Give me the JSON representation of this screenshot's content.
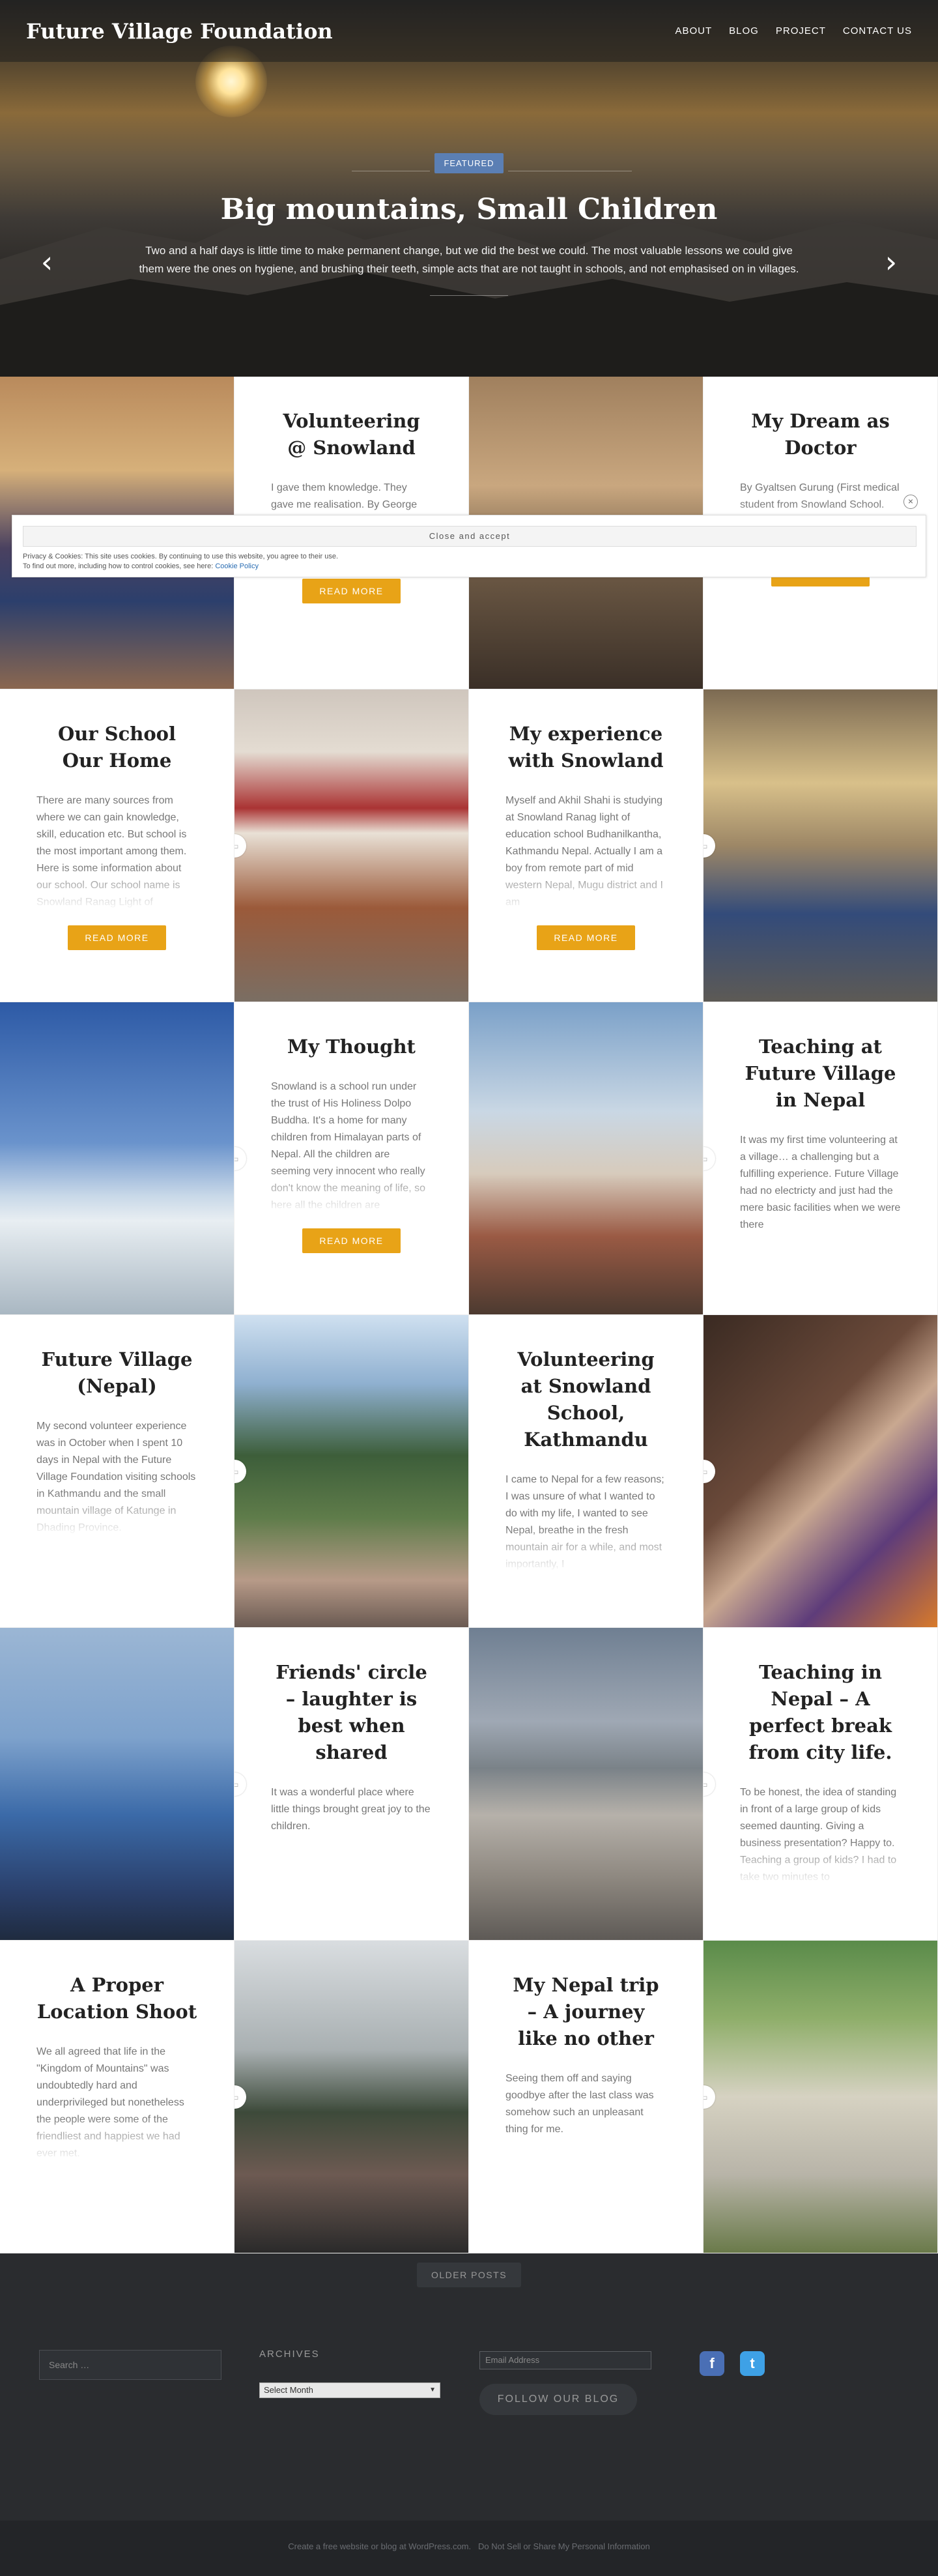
{
  "site": {
    "title": "Future Village Foundation"
  },
  "nav": [
    {
      "label": "ABOUT"
    },
    {
      "label": "BLOG"
    },
    {
      "label": "PROJECT"
    },
    {
      "label": "CONTACT US"
    }
  ],
  "hero": {
    "badge": "FEATURED",
    "title": "Big mountains, Small Children",
    "excerpt": "Two and a half days is little time to make permanent change, but we did the best we could. The most valuable lessons we could give them were the ones on hygiene, and brushing their teeth, simple acts that are not taught in schools, and not emphasised on in villages.",
    "prev_icon": "chevron-left-icon",
    "next_icon": "chevron-right-icon"
  },
  "posts": [
    {
      "title": "Volunteering @ Snowland",
      "excerpt": "I gave them knowledge. They gave me realisation. By George Cotterill. I spent two weeks volunteering at Snowland school in Kathmandu, Nepal. After",
      "read_more": "READ MORE"
    },
    {
      "title": "My Dream as Doctor",
      "excerpt": "By Gyaltsen Gurung (First medical student from Snowland School. Currently studying in 2nd year of MBBS (Bachelor of Medicine and",
      "read_more": "READ MORE"
    },
    {
      "title": "Our School Our Home",
      "excerpt": "There are many sources from where we can gain knowledge, skill, education etc. But school is the most important among them. Here is some information about our school. Our school name is Snowland Ranag Light of",
      "read_more": "READ MORE"
    },
    {
      "title": "My experience with Snowland",
      "excerpt": "Myself and Akhil Shahi is studying at Snowland Ranag light of education school Budhanilkantha, Kathmandu Nepal. Actually I am a boy from remote part of mid western Nepal, Mugu district and I am",
      "read_more": "READ MORE"
    },
    {
      "title": "My Thought",
      "excerpt": "Snowland is a school run under the trust of His Holiness Dolpo Buddha. It's a home for many children from Himalayan parts of Nepal. All the children are seeming very innocent who really don't know the meaning of life, so here all the children are",
      "read_more": "READ MORE"
    },
    {
      "title": "Teaching at Future Village in Nepal",
      "excerpt": "It was my first time volunteering at a village… a challenging but a fulfilling experience. Future Village had no electricty and just had the mere basic facilities when we were there"
    },
    {
      "title": "Future Village (Nepal)",
      "excerpt": "My second volunteer experience was in October when I spent 10 days in Nepal with the Future Village Foundation visiting schools in Kathmandu and the small mountain village of Katunge in Dhading Province."
    },
    {
      "title": "Volunteering at Snowland School, Kathmandu",
      "excerpt": "I came to Nepal for a few reasons; I was unsure of what I wanted to do with my life, I wanted to see Nepal, breathe in the fresh mountain air for a while, and most importantly, I"
    },
    {
      "title": "Friends' circle – laughter is best when shared",
      "excerpt": "It was a wonderful place where little things brought great joy to the children."
    },
    {
      "title": "Teaching in Nepal – A perfect break from city life.",
      "excerpt": "To be honest, the idea of standing in front of a large group of kids seemed daunting. Giving a business presentation? Happy to. Teaching a group of kids? I had to take two minutes to"
    },
    {
      "title": "A Proper Location Shoot",
      "excerpt": "We all agreed that life in the \"Kingdom of Mountains\" was undoubtedly hard and underprivileged but nonetheless the people were some of the friendliest and happiest we had ever met."
    },
    {
      "title": "My Nepal trip – A journey like no other",
      "excerpt": "Seeing them off and saying goodbye after the last class was somehow such an unpleasant thing for me."
    }
  ],
  "cookie": {
    "button": "Close and accept",
    "line1": "Privacy & Cookies: This site uses cookies. By continuing to use this website, you agree to their use.",
    "line2": "To find out more, including how to control cookies, see here: ",
    "link": "Cookie Policy",
    "close": "×"
  },
  "footer": {
    "older_posts": "OLDER POSTS",
    "search_placeholder": "Search …",
    "archives_title": "ARCHIVES",
    "archives_select": "Select Month",
    "email_placeholder": "Email Address",
    "follow": "FOLLOW OUR BLOG",
    "facebook_icon": "f",
    "twitter_icon": "t",
    "credit": "Create a free website or blog at WordPress.com.",
    "privacy": "Do Not Sell or Share My Personal Information"
  },
  "colors": {
    "accent": "#e8a317",
    "badge": "#5b7fb4",
    "footer": "#2a2c2f"
  }
}
